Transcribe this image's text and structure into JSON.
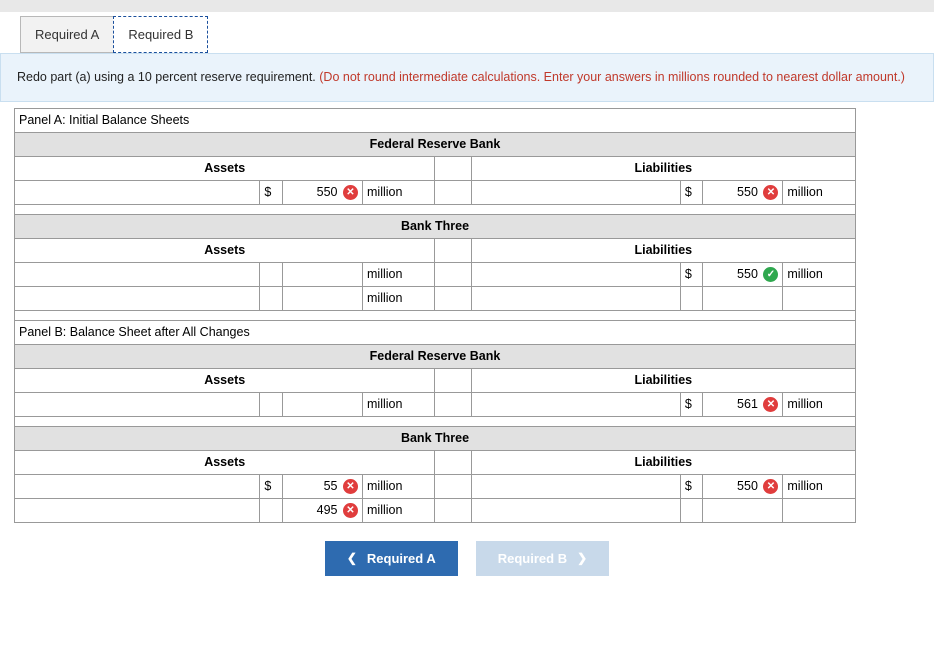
{
  "tabs": {
    "a": "Required A",
    "b": "Required B"
  },
  "instruction": {
    "black": "Redo part (a) using a 10 percent reserve requirement. ",
    "red": "(Do not round intermediate calculations. Enter your answers in millions rounded to nearest dollar amount.)"
  },
  "panelA": {
    "title": "Panel A: Initial Balance Sheets",
    "frb": {
      "name": "Federal Reserve Bank",
      "assets_label": "Assets",
      "liab_label": "Liabilities",
      "row1": {
        "a_dollar": "$",
        "a_val": "550",
        "a_status": "wrong",
        "a_unit": "million",
        "l_dollar": "$",
        "l_val": "550",
        "l_status": "wrong",
        "l_unit": "million"
      }
    },
    "b3": {
      "name": "Bank Three",
      "assets_label": "Assets",
      "liab_label": "Liabilities",
      "row1": {
        "a_unit": "million",
        "l_dollar": "$",
        "l_val": "550",
        "l_status": "correct",
        "l_unit": "million"
      },
      "row2": {
        "a_unit": "million"
      }
    }
  },
  "panelB": {
    "title": "Panel B: Balance Sheet after All Changes",
    "frb": {
      "name": "Federal Reserve Bank",
      "assets_label": "Assets",
      "liab_label": "Liabilities",
      "row1": {
        "a_unit": "million",
        "l_dollar": "$",
        "l_val": "561",
        "l_status": "wrong",
        "l_unit": "million"
      }
    },
    "b3": {
      "name": "Bank Three",
      "assets_label": "Assets",
      "liab_label": "Liabilities",
      "row1": {
        "a_dollar": "$",
        "a_val": "55",
        "a_status": "wrong",
        "a_unit": "million",
        "l_dollar": "$",
        "l_val": "550",
        "l_status": "wrong",
        "l_unit": "million"
      },
      "row2": {
        "a_val": "495",
        "a_status": "wrong",
        "a_unit": "million"
      }
    }
  },
  "nav": {
    "prev": "Required A",
    "next": "Required B"
  },
  "icons": {
    "wrong": "✕",
    "correct": "✓",
    "chev_left": "❮",
    "chev_right": "❯"
  }
}
